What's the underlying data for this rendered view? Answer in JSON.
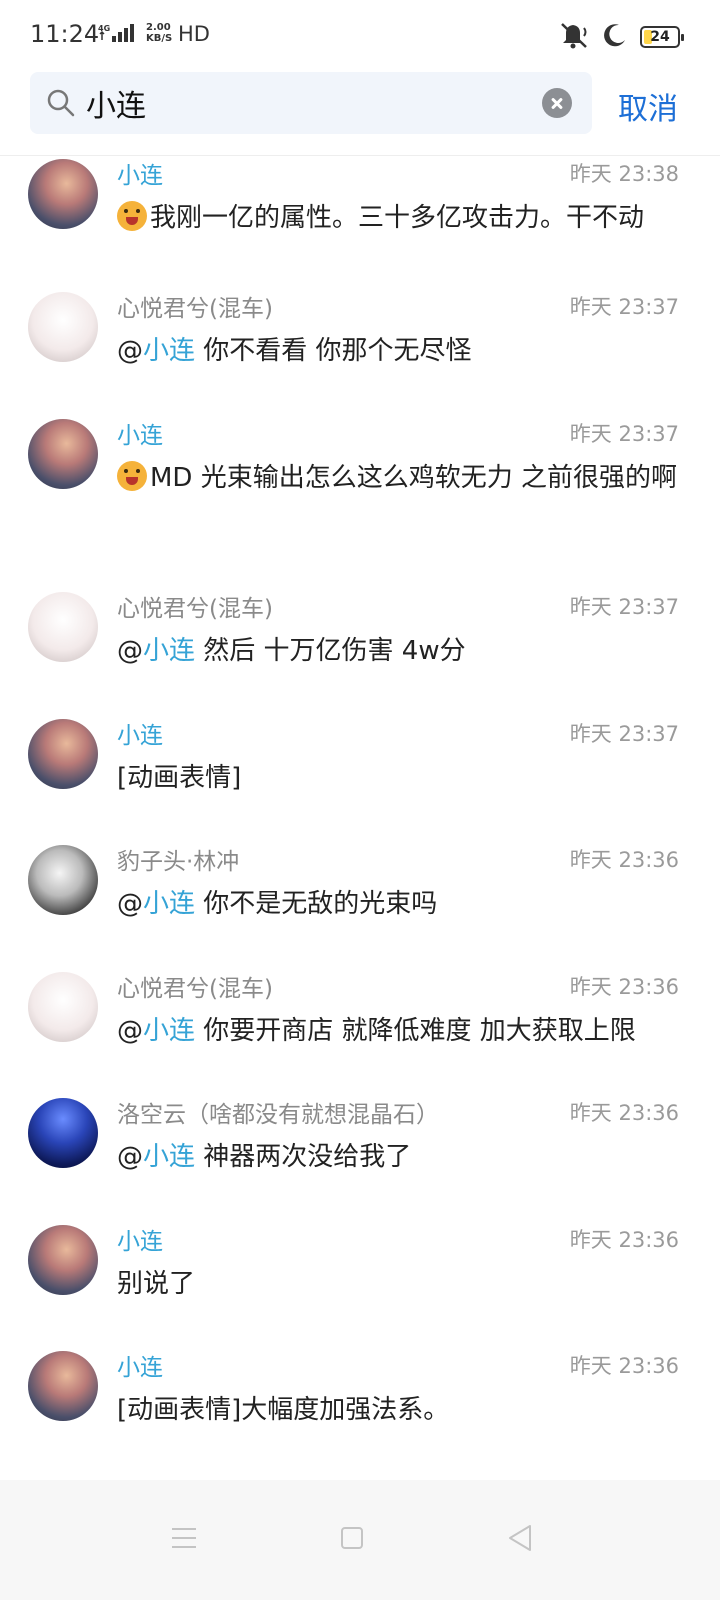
{
  "status_bar": {
    "time": "11:24",
    "net_speed_line1": "2.00",
    "net_speed_line2": "KB/S",
    "hd": "HD",
    "battery": "24",
    "battery_level": 0.24
  },
  "search": {
    "query": "小连",
    "cancel_label": "取消"
  },
  "results": [
    {
      "sender": "小连",
      "self": true,
      "time": "昨天 23:38",
      "avatar": "sunset",
      "parts": [
        {
          "emoji": true
        },
        {
          "text": "我刚一亿的属性。三十多亿攻击力。干不动"
        }
      ]
    },
    {
      "sender": "心悦君兮(混车)",
      "self": false,
      "time": "昨天 23:37",
      "avatar": "cat",
      "parts": [
        {
          "text": "@"
        },
        {
          "text": "小连",
          "mention": true
        },
        {
          "text": " 你不看看 你那个无尽怪"
        }
      ]
    },
    {
      "sender": "小连",
      "self": true,
      "time": "昨天 23:37",
      "avatar": "sunset",
      "parts": [
        {
          "emoji": true
        },
        {
          "text": "MD 光束输出怎么这么鸡软无力 之前很强的啊"
        }
      ]
    },
    {
      "sender": "心悦君兮(混车)",
      "self": false,
      "time": "昨天 23:37",
      "avatar": "cat",
      "parts": [
        {
          "text": "@"
        },
        {
          "text": "小连",
          "mention": true
        },
        {
          "text": " 然后 十万亿伤害 4w分"
        }
      ]
    },
    {
      "sender": "小连",
      "self": true,
      "time": "昨天 23:37",
      "avatar": "sunset",
      "parts": [
        {
          "text": "[动画表情]"
        }
      ]
    },
    {
      "sender": "豹子头·林冲",
      "self": false,
      "time": "昨天 23:36",
      "avatar": "bw",
      "parts": [
        {
          "text": "@"
        },
        {
          "text": "小连",
          "mention": true
        },
        {
          "text": " 你不是无敌的光束吗"
        }
      ]
    },
    {
      "sender": "心悦君兮(混车)",
      "self": false,
      "time": "昨天 23:36",
      "avatar": "cat",
      "parts": [
        {
          "text": "@"
        },
        {
          "text": "小连",
          "mention": true
        },
        {
          "text": " 你要开商店 就降低难度 加大获取上限"
        }
      ]
    },
    {
      "sender": "洛空云（啥都没有就想混晶石）",
      "self": false,
      "time": "昨天 23:36",
      "avatar": "night",
      "parts": [
        {
          "text": "@"
        },
        {
          "text": "小连",
          "mention": true
        },
        {
          "text": " 神器两次没给我了"
        }
      ]
    },
    {
      "sender": "小连",
      "self": true,
      "time": "昨天 23:36",
      "avatar": "sunset",
      "parts": [
        {
          "text": "别说了"
        }
      ]
    },
    {
      "sender": "小连",
      "self": true,
      "time": "昨天 23:36",
      "avatar": "sunset",
      "parts": [
        {
          "text": "[动画表情]大幅度加强法系。"
        }
      ]
    }
  ]
}
